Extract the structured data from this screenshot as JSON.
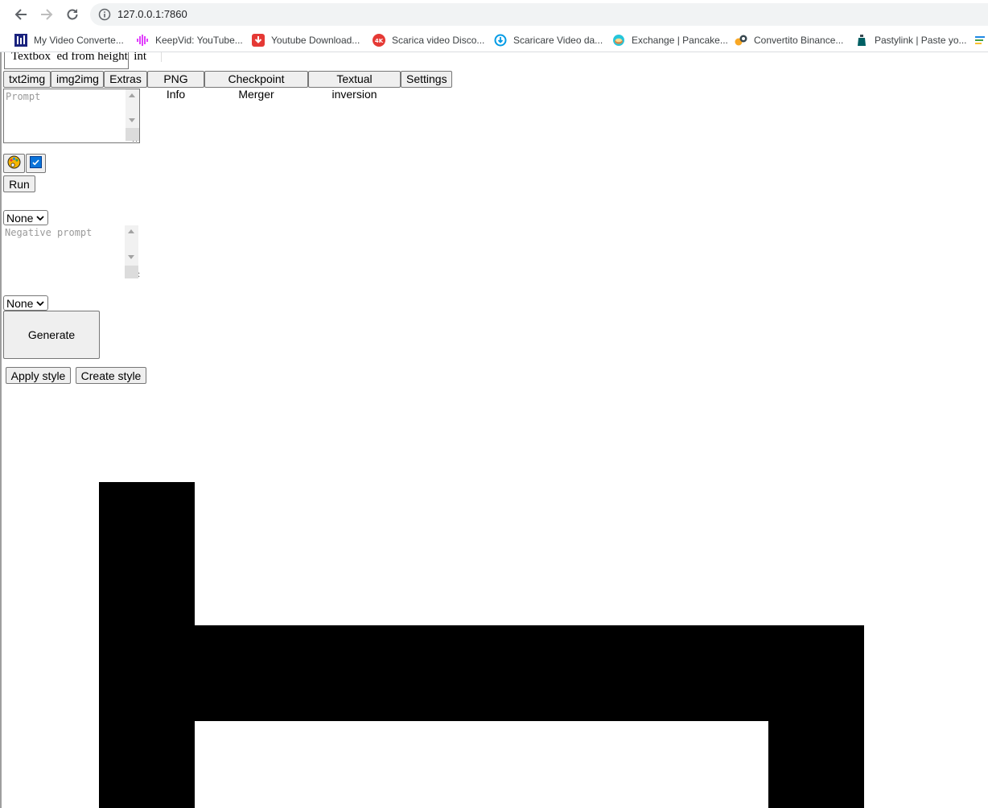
{
  "browser": {
    "url": "127.0.0.1:7860",
    "bookmarks": [
      {
        "label": "My Video Converte...",
        "icon": "video-converter-icon",
        "color": "#1a237e"
      },
      {
        "label": "KeepVid: YouTube...",
        "icon": "keepvid-icon",
        "color": "#e040fb"
      },
      {
        "label": "Youtube Download...",
        "icon": "download-icon",
        "color": "#e53935"
      },
      {
        "label": "Scarica video Disco...",
        "icon": "4k-icon",
        "color": "#e53935"
      },
      {
        "label": "Scaricare Video da...",
        "icon": "download-circle-icon",
        "color": "#039be5"
      },
      {
        "label": "Exchange | Pancake...",
        "icon": "pancake-icon",
        "color": "#26c6da"
      },
      {
        "label": "Convertito Binance...",
        "icon": "exchange-icon",
        "color": "#f9a825"
      },
      {
        "label": "Pastylink | Paste yo...",
        "icon": "pastylink-icon",
        "color": "#006064"
      }
    ]
  },
  "page": {
    "clipped_textbox_text": "Textbox  ed from height  int",
    "tabs": [
      "txt2img",
      "img2img",
      "Extras",
      "PNG Info",
      "Checkpoint Merger",
      "Textual inversion",
      "Settings"
    ],
    "prompt_placeholder": "Prompt",
    "negative_prompt_placeholder": "Negative prompt",
    "run_label": "Run",
    "style1_selected": "None",
    "style2_selected": "None",
    "generate_label": "Generate",
    "apply_style_label": "Apply style",
    "create_style_label": "Create style",
    "palette_icon": "palette-icon",
    "checkbox_icon": "checkbox-icon",
    "checkbox_checked": true
  },
  "colors": {
    "chrome_bg": "#ffffff",
    "omnibox_bg": "#f1f3f4",
    "button_bg": "#efefef",
    "border": "#767676",
    "checkbox_blue": "#0a74da",
    "glyph_black": "#000000"
  }
}
